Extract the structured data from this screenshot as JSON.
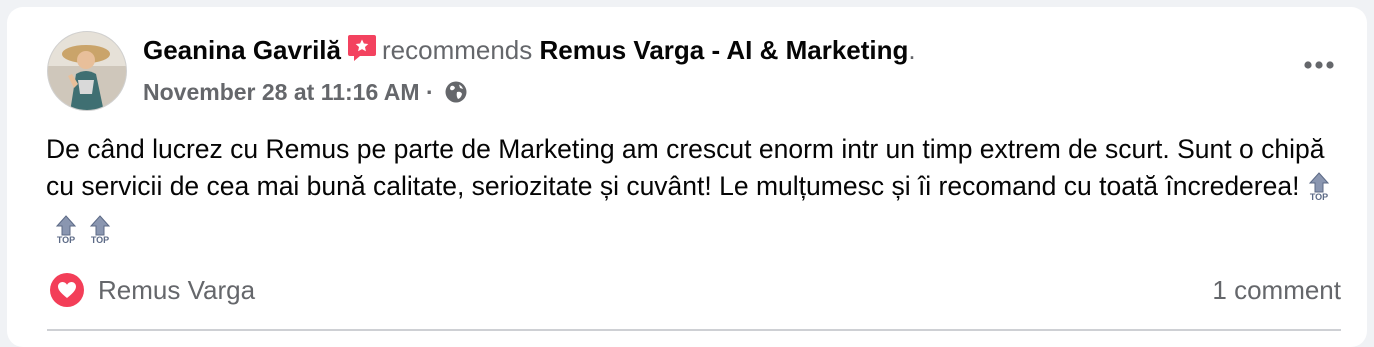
{
  "post": {
    "author": "Geanina Gavrilă",
    "recommends_text": "recommends",
    "page_name": "Remus Varga - AI & Marketing",
    "period": ".",
    "timestamp": "November 28 at 11:16 AM",
    "separator": "·",
    "privacy_icon": "globe-icon",
    "more_icon": "more-horizontal-icon",
    "body": "De când lucrez cu Remus pe parte de Marketing am crescut enorm intr un timp extrem de scurt. Sunt o chipă cu servicii de cea mai bună calitate, seriozitate și cuvânt! Le mulțumesc și îi recomand cu toată încrederea!",
    "emoji": [
      {
        "icon": "top-arrow-icon",
        "label": "TOP"
      },
      {
        "icon": "top-arrow-icon",
        "label": "TOP"
      },
      {
        "icon": "top-arrow-icon",
        "label": "TOP"
      }
    ]
  },
  "footer": {
    "reaction_icon": "love-reaction-icon",
    "reactor_name": "Remus Varga",
    "comment_count": "1 comment"
  },
  "colors": {
    "page_bg": "#f0f2f5",
    "card_bg": "#ffffff",
    "text_primary": "#050505",
    "text_secondary": "#65676b",
    "recommend_badge": "#f3425f",
    "love_reaction": "#f33e58"
  }
}
